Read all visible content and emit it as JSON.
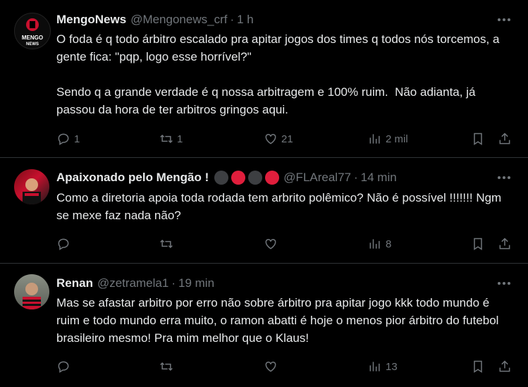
{
  "tweets": [
    {
      "name": "MengoNews",
      "handle": "@Mengonews_crf",
      "time": "1 h",
      "avatar_text": "MENGO NEWS",
      "text": "O foda é q todo árbitro escalado pra apitar jogos dos times q todos nós torcemos, a gente fica: \"pqp, logo esse horrível?\"\n\nSendo q a grande verdade é q nossa arbitragem e 100% ruim.  Não adianta, já passou da hora de ter arbitros gringos aqui.",
      "replies": "1",
      "retweets": "1",
      "likes": "21",
      "views": "2 mil"
    },
    {
      "name": "Apaixonado pelo Mengão !",
      "handle": "@FLAreal77",
      "time": "14 min",
      "text": "Como a diretoria apoia toda rodada tem arbrito polêmico? Não é possível !!!!!!! Ngm se mexe faz nada não?",
      "replies": "",
      "retweets": "",
      "likes": "",
      "views": "8",
      "badge_colors": [
        "#3d3f42",
        "#e01e3c",
        "#3d3f42",
        "#e01e3c"
      ]
    },
    {
      "name": "Renan",
      "handle": "@zetramela1",
      "time": "19 min",
      "text": "Mas se afastar arbitro por erro não sobre árbitro pra apitar jogo kkk todo mundo é ruim e todo mundo erra muito, o ramon abatti é hoje o menos pior árbitro do futebol brasileiro mesmo! Pra mim melhor que o Klaus!",
      "replies": "",
      "retweets": "",
      "likes": "",
      "views": "13"
    }
  ],
  "colors": {
    "muted": "#71767b",
    "text": "#e7e9ea",
    "divider": "#2f3336",
    "accent_red": "#e01e3c"
  }
}
